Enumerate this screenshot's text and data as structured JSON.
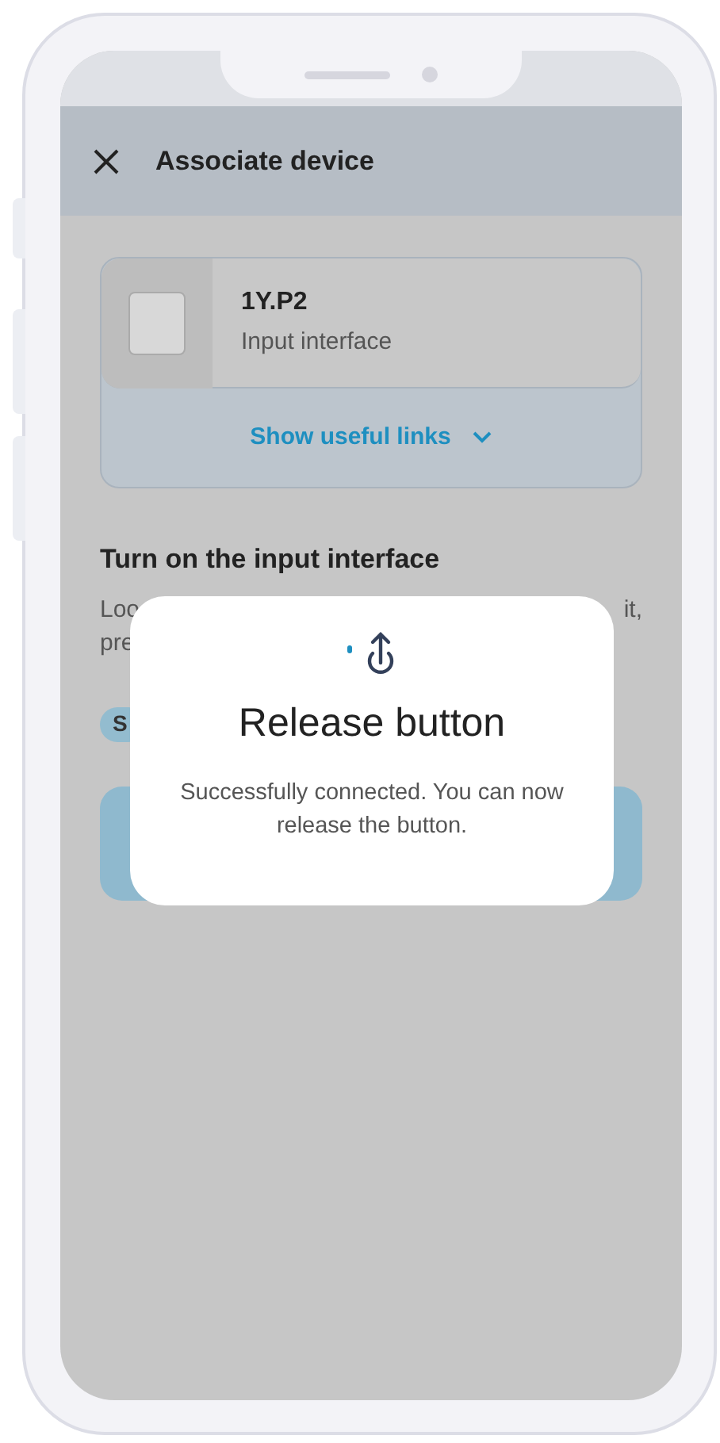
{
  "header": {
    "title": "Associate device"
  },
  "device_card": {
    "model": "1Y.P2",
    "type": "Input interface",
    "links_toggle": "Show useful links",
    "expanded": false
  },
  "section": {
    "title": "Turn on the input interface",
    "text_fragments": [
      "Loo",
      "it,",
      "pre"
    ],
    "badge_fragment": "S"
  },
  "dialog": {
    "title": "Release button",
    "message": "Successfully connected. You can now release the button."
  }
}
